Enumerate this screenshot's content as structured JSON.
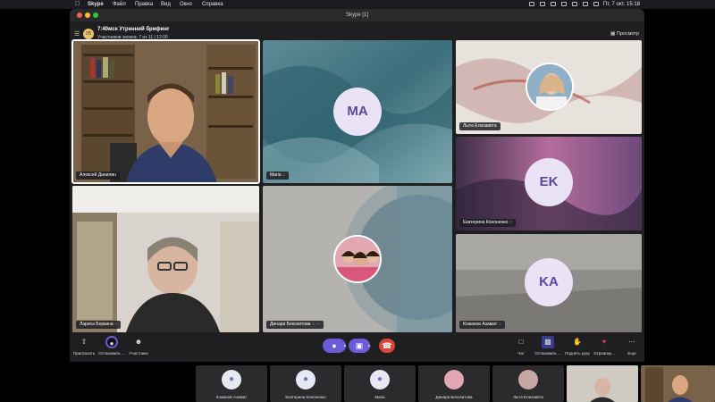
{
  "menubar": {
    "app_name": "Skype",
    "items": [
      "Файл",
      "Правка",
      "Вид",
      "Окно",
      "Справка"
    ],
    "clock": "Пт, 7 окт. 15:18"
  },
  "window": {
    "title": "Skype [1]"
  },
  "call": {
    "avatar_initials": "УБ",
    "title": "7:40мск Утренний брифинг",
    "subtitle": "Участников звонка: 7 из 11 | 12:00",
    "view_label": "Просмотр"
  },
  "tiles": {
    "aleksey": {
      "name": "Алексей Данилин"
    },
    "maria": {
      "name": "Maria",
      "initials": "MA"
    },
    "lyta": {
      "name": "Лыта Елизавета"
    },
    "ekaterina": {
      "name": "Екатерина Кононенко",
      "initials": "EK"
    },
    "larisa": {
      "name": "Лариса Беркина"
    },
    "dinara": {
      "name": "Динара Бексеитова"
    },
    "kozhanov": {
      "name": "Кожанов Азамат",
      "initials": "KA"
    }
  },
  "toolbar": {
    "invite_label": "Пригласить",
    "stop_video_label": "Остановить ...",
    "participants_label": "Участники",
    "chat_label": "Чат",
    "stop_share_label": "Остановить ...",
    "raise_hand_label": "Поднять руку",
    "react_label": "Отреагир...",
    "more_label": "Еще"
  },
  "strip": [
    {
      "name": "Кожанов Азамат",
      "type": "avatar"
    },
    {
      "name": "Екатерина Кононенко",
      "type": "avatar"
    },
    {
      "name": "Maria",
      "type": "avatar"
    },
    {
      "name": "Динара Бексеитова",
      "type": "photo"
    },
    {
      "name": "Лыта Елизавета",
      "type": "photo"
    }
  ],
  "colors": {
    "accent_purple": "#6b5bd6",
    "end_call_red": "#d9463a",
    "initials_text": "#5a4a9c"
  }
}
